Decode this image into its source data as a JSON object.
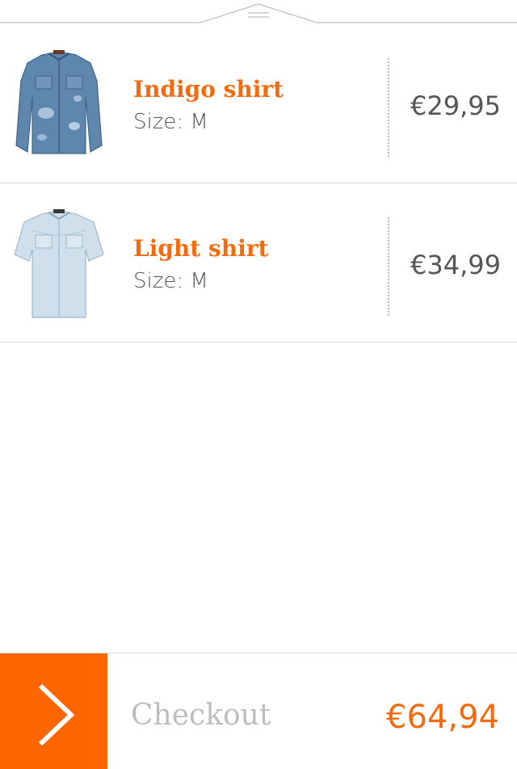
{
  "colors": {
    "accent": "#ff6600",
    "item_title": "#f26b10",
    "text": "#555555",
    "muted": "#bdbdbd",
    "divider": "#d9d9d9"
  },
  "top_handle": {
    "icon": "pull-handle-icon"
  },
  "cart": {
    "items": [
      {
        "name": "Indigo shirt",
        "size": "Size: M",
        "price": "€29,95",
        "image": "denim-long-sleeve-shirt"
      },
      {
        "name": "Light shirt",
        "size": "Size: M",
        "price": "€34,99",
        "image": "light-denim-short-sleeve-shirt"
      }
    ]
  },
  "checkout": {
    "label": "Checkout",
    "total": "€64,94",
    "icon": "chevron-right-icon"
  }
}
